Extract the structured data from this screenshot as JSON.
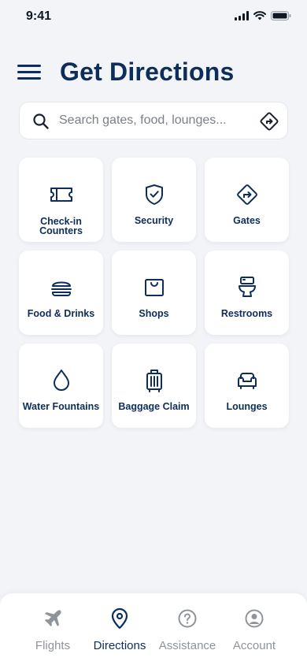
{
  "status_bar": {
    "time": "9:41"
  },
  "header": {
    "title": "Get Directions"
  },
  "search": {
    "placeholder": "Search gates, food, lounges..."
  },
  "categories": [
    {
      "label_line1": "Check-in",
      "label_line2": "Counters",
      "icon": "ticket-icon"
    },
    {
      "label": "Security",
      "icon": "shield-check-icon"
    },
    {
      "label": "Gates",
      "icon": "turn-right-sign-icon"
    },
    {
      "label": "Food & Drinks",
      "icon": "burger-icon"
    },
    {
      "label": "Shops",
      "icon": "shopping-bag-icon"
    },
    {
      "label": "Restrooms",
      "icon": "toilet-icon"
    },
    {
      "label": "Water Fountains",
      "icon": "water-drop-icon"
    },
    {
      "label": "Baggage Claim",
      "icon": "luggage-icon"
    },
    {
      "label": "Lounges",
      "icon": "armchair-icon"
    }
  ],
  "bottom_nav": {
    "items": [
      {
        "label": "Flights",
        "icon": "airplane-icon",
        "active": false
      },
      {
        "label": "Directions",
        "icon": "location-pin-icon",
        "active": true
      },
      {
        "label": "Assistance",
        "icon": "help-circle-icon",
        "active": false
      },
      {
        "label": "Account",
        "icon": "user-circle-icon",
        "active": false
      }
    ]
  },
  "colors": {
    "primary": "#0d2d5a",
    "background": "#f2f4f7",
    "inactive": "#8f949b"
  }
}
